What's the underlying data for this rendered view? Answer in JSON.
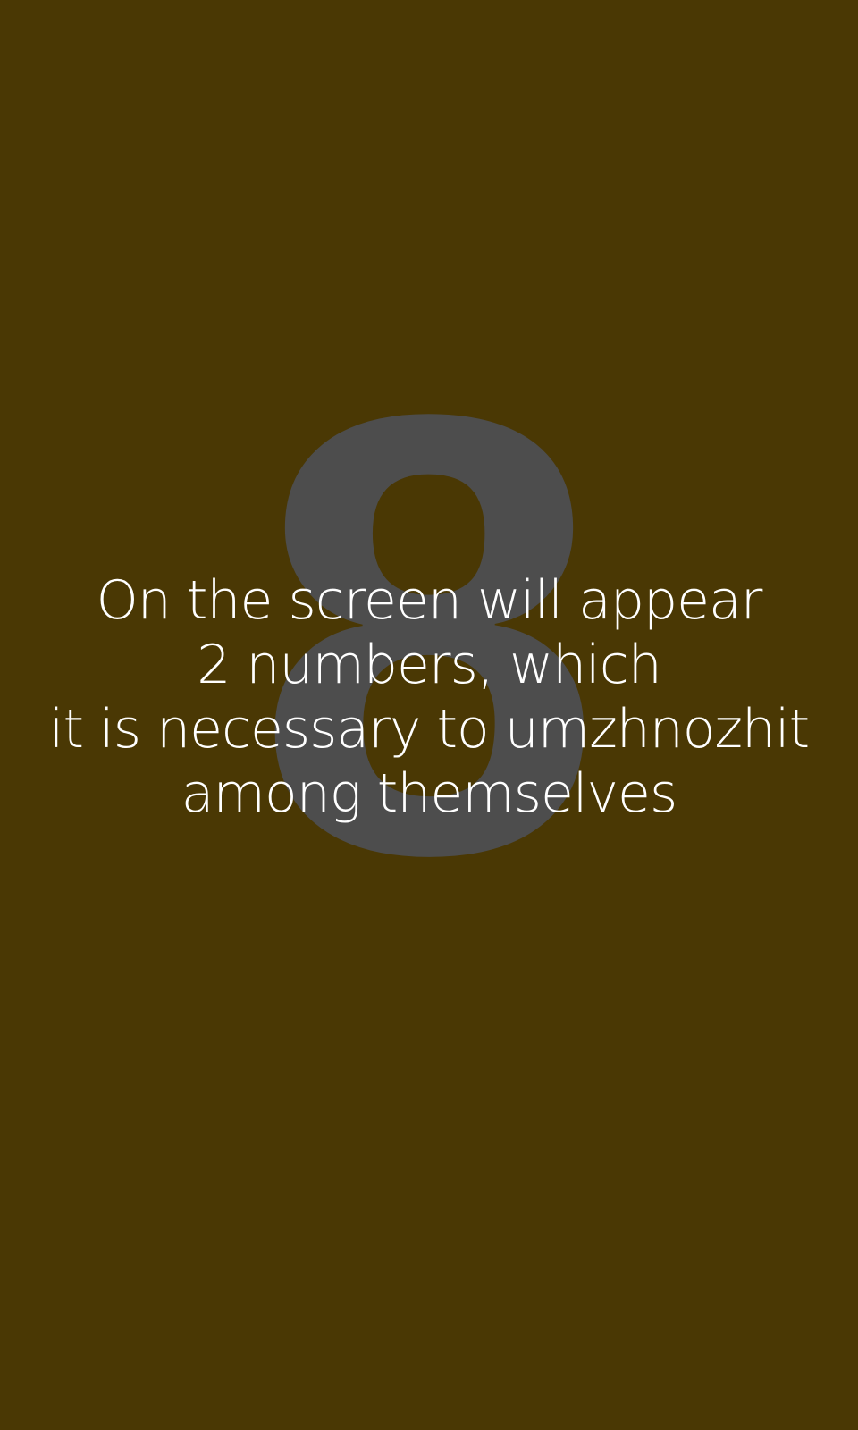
{
  "colors": {
    "background": "#4a3804",
    "countdown_digit": "#4d4d4d",
    "instruction_text": "#ffffff"
  },
  "countdown": {
    "digit": "8"
  },
  "instructions": {
    "lines": [
      "On the screen will appear",
      "2 numbers, which",
      "it is necessary to umzhnozhit",
      "among themselves"
    ]
  }
}
